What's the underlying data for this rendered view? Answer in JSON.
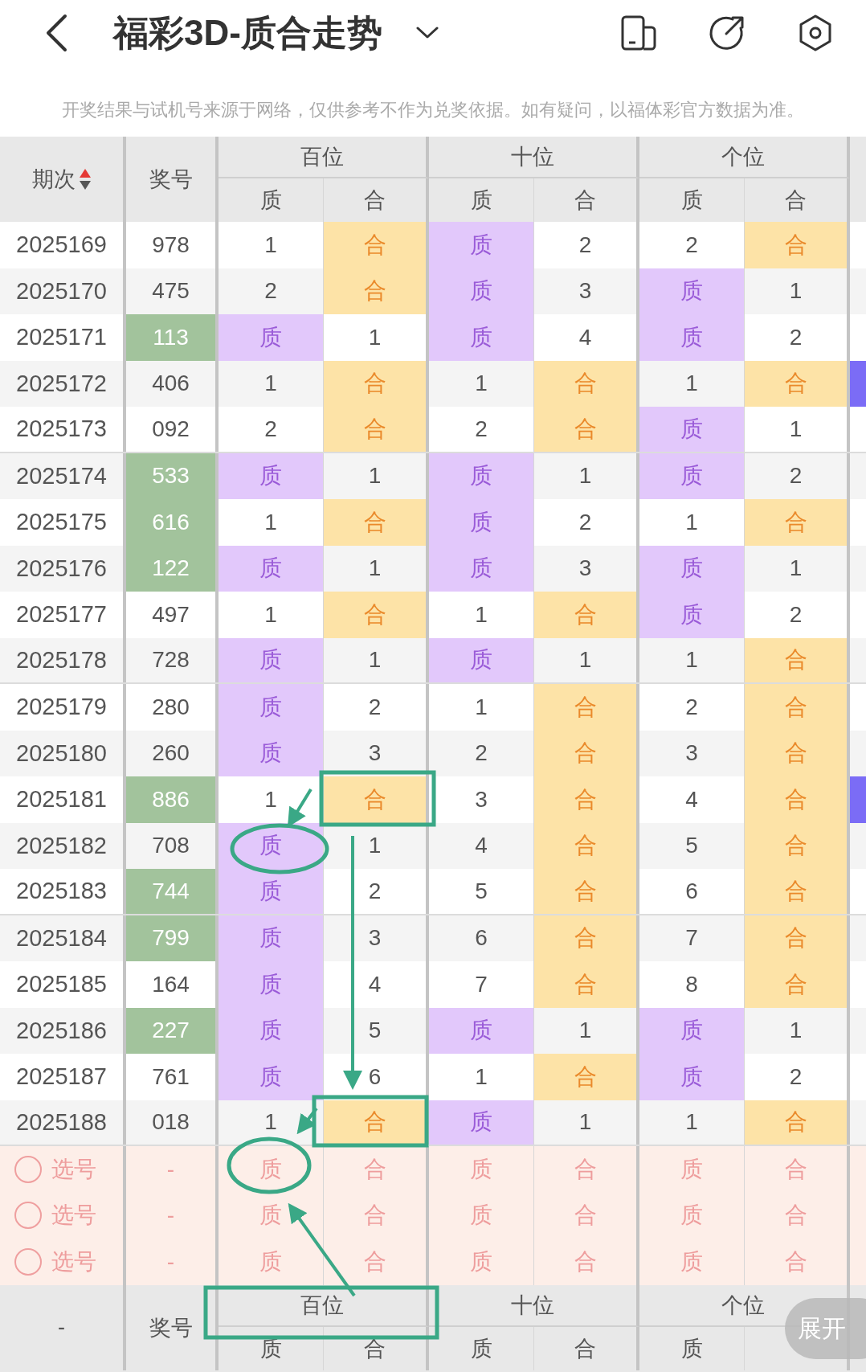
{
  "top_bar": {
    "title": "福彩3D-质合走势"
  },
  "notice": "开奖结果与试机号来源于网络，仅供参考不作为兑奖依据。如有疑问，以福体彩官方数据为准。",
  "table": {
    "header": {
      "issue": "期次",
      "number": "奖号",
      "groups": [
        {
          "label": "百位",
          "subs": [
            "质",
            "合"
          ]
        },
        {
          "label": "十位",
          "subs": [
            "质",
            "合"
          ]
        },
        {
          "label": "个位",
          "subs": [
            "质",
            "合"
          ]
        }
      ]
    },
    "rows": [
      {
        "issue": "2025169",
        "number": "978",
        "highlight": false,
        "edge_marker": false,
        "cells": [
          {
            "text": "1",
            "hit": false
          },
          {
            "text": "合",
            "hit": true
          },
          {
            "text": "质",
            "hit": true
          },
          {
            "text": "2",
            "hit": false
          },
          {
            "text": "2",
            "hit": false
          },
          {
            "text": "合",
            "hit": true
          }
        ]
      },
      {
        "issue": "2025170",
        "number": "475",
        "highlight": false,
        "edge_marker": false,
        "cells": [
          {
            "text": "2",
            "hit": false
          },
          {
            "text": "合",
            "hit": true
          },
          {
            "text": "质",
            "hit": true
          },
          {
            "text": "3",
            "hit": false
          },
          {
            "text": "质",
            "hit": true
          },
          {
            "text": "1",
            "hit": false
          }
        ]
      },
      {
        "issue": "2025171",
        "number": "113",
        "highlight": true,
        "edge_marker": false,
        "cells": [
          {
            "text": "质",
            "hit": true
          },
          {
            "text": "1",
            "hit": false
          },
          {
            "text": "质",
            "hit": true
          },
          {
            "text": "4",
            "hit": false
          },
          {
            "text": "质",
            "hit": true
          },
          {
            "text": "2",
            "hit": false
          }
        ]
      },
      {
        "issue": "2025172",
        "number": "406",
        "highlight": false,
        "edge_marker": true,
        "cells": [
          {
            "text": "1",
            "hit": false
          },
          {
            "text": "合",
            "hit": true
          },
          {
            "text": "1",
            "hit": false
          },
          {
            "text": "合",
            "hit": true
          },
          {
            "text": "1",
            "hit": false
          },
          {
            "text": "合",
            "hit": true
          }
        ]
      },
      {
        "issue": "2025173",
        "number": "092",
        "highlight": false,
        "edge_marker": false,
        "cells": [
          {
            "text": "2",
            "hit": false
          },
          {
            "text": "合",
            "hit": true
          },
          {
            "text": "2",
            "hit": false
          },
          {
            "text": "合",
            "hit": true
          },
          {
            "text": "质",
            "hit": true
          },
          {
            "text": "1",
            "hit": false
          }
        ]
      },
      {
        "issue": "2025174",
        "number": "533",
        "highlight": true,
        "edge_marker": false,
        "cells": [
          {
            "text": "质",
            "hit": true
          },
          {
            "text": "1",
            "hit": false
          },
          {
            "text": "质",
            "hit": true
          },
          {
            "text": "1",
            "hit": false
          },
          {
            "text": "质",
            "hit": true
          },
          {
            "text": "2",
            "hit": false
          }
        ]
      },
      {
        "issue": "2025175",
        "number": "616",
        "highlight": true,
        "edge_marker": false,
        "cells": [
          {
            "text": "1",
            "hit": false
          },
          {
            "text": "合",
            "hit": true
          },
          {
            "text": "质",
            "hit": true
          },
          {
            "text": "2",
            "hit": false
          },
          {
            "text": "1",
            "hit": false
          },
          {
            "text": "合",
            "hit": true
          }
        ]
      },
      {
        "issue": "2025176",
        "number": "122",
        "highlight": true,
        "edge_marker": false,
        "cells": [
          {
            "text": "质",
            "hit": true
          },
          {
            "text": "1",
            "hit": false
          },
          {
            "text": "质",
            "hit": true
          },
          {
            "text": "3",
            "hit": false
          },
          {
            "text": "质",
            "hit": true
          },
          {
            "text": "1",
            "hit": false
          }
        ]
      },
      {
        "issue": "2025177",
        "number": "497",
        "highlight": false,
        "edge_marker": false,
        "cells": [
          {
            "text": "1",
            "hit": false
          },
          {
            "text": "合",
            "hit": true
          },
          {
            "text": "1",
            "hit": false
          },
          {
            "text": "合",
            "hit": true
          },
          {
            "text": "质",
            "hit": true
          },
          {
            "text": "2",
            "hit": false
          }
        ]
      },
      {
        "issue": "2025178",
        "number": "728",
        "highlight": false,
        "edge_marker": false,
        "cells": [
          {
            "text": "质",
            "hit": true
          },
          {
            "text": "1",
            "hit": false
          },
          {
            "text": "质",
            "hit": true
          },
          {
            "text": "1",
            "hit": false
          },
          {
            "text": "1",
            "hit": false
          },
          {
            "text": "合",
            "hit": true
          }
        ]
      },
      {
        "issue": "2025179",
        "number": "280",
        "highlight": false,
        "edge_marker": false,
        "cells": [
          {
            "text": "质",
            "hit": true
          },
          {
            "text": "2",
            "hit": false
          },
          {
            "text": "1",
            "hit": false
          },
          {
            "text": "合",
            "hit": true
          },
          {
            "text": "2",
            "hit": false
          },
          {
            "text": "合",
            "hit": true
          }
        ]
      },
      {
        "issue": "2025180",
        "number": "260",
        "highlight": false,
        "edge_marker": false,
        "cells": [
          {
            "text": "质",
            "hit": true
          },
          {
            "text": "3",
            "hit": false
          },
          {
            "text": "2",
            "hit": false
          },
          {
            "text": "合",
            "hit": true
          },
          {
            "text": "3",
            "hit": false
          },
          {
            "text": "合",
            "hit": true
          }
        ]
      },
      {
        "issue": "2025181",
        "number": "886",
        "highlight": true,
        "edge_marker": true,
        "cells": [
          {
            "text": "1",
            "hit": false
          },
          {
            "text": "合",
            "hit": true
          },
          {
            "text": "3",
            "hit": false
          },
          {
            "text": "合",
            "hit": true
          },
          {
            "text": "4",
            "hit": false
          },
          {
            "text": "合",
            "hit": true
          }
        ]
      },
      {
        "issue": "2025182",
        "number": "708",
        "highlight": false,
        "edge_marker": false,
        "cells": [
          {
            "text": "质",
            "hit": true
          },
          {
            "text": "1",
            "hit": false
          },
          {
            "text": "4",
            "hit": false
          },
          {
            "text": "合",
            "hit": true
          },
          {
            "text": "5",
            "hit": false
          },
          {
            "text": "合",
            "hit": true
          }
        ]
      },
      {
        "issue": "2025183",
        "number": "744",
        "highlight": true,
        "edge_marker": false,
        "cells": [
          {
            "text": "质",
            "hit": true
          },
          {
            "text": "2",
            "hit": false
          },
          {
            "text": "5",
            "hit": false
          },
          {
            "text": "合",
            "hit": true
          },
          {
            "text": "6",
            "hit": false
          },
          {
            "text": "合",
            "hit": true
          }
        ]
      },
      {
        "issue": "2025184",
        "number": "799",
        "highlight": true,
        "edge_marker": false,
        "cells": [
          {
            "text": "质",
            "hit": true
          },
          {
            "text": "3",
            "hit": false
          },
          {
            "text": "6",
            "hit": false
          },
          {
            "text": "合",
            "hit": true
          },
          {
            "text": "7",
            "hit": false
          },
          {
            "text": "合",
            "hit": true
          }
        ]
      },
      {
        "issue": "2025185",
        "number": "164",
        "highlight": false,
        "edge_marker": false,
        "cells": [
          {
            "text": "质",
            "hit": true
          },
          {
            "text": "4",
            "hit": false
          },
          {
            "text": "7",
            "hit": false
          },
          {
            "text": "合",
            "hit": true
          },
          {
            "text": "8",
            "hit": false
          },
          {
            "text": "合",
            "hit": true
          }
        ]
      },
      {
        "issue": "2025186",
        "number": "227",
        "highlight": true,
        "edge_marker": false,
        "cells": [
          {
            "text": "质",
            "hit": true
          },
          {
            "text": "5",
            "hit": false
          },
          {
            "text": "质",
            "hit": true
          },
          {
            "text": "1",
            "hit": false
          },
          {
            "text": "质",
            "hit": true
          },
          {
            "text": "1",
            "hit": false
          }
        ]
      },
      {
        "issue": "2025187",
        "number": "761",
        "highlight": false,
        "edge_marker": false,
        "cells": [
          {
            "text": "质",
            "hit": true
          },
          {
            "text": "6",
            "hit": false
          },
          {
            "text": "1",
            "hit": false
          },
          {
            "text": "合",
            "hit": true
          },
          {
            "text": "质",
            "hit": true
          },
          {
            "text": "2",
            "hit": false
          }
        ]
      },
      {
        "issue": "2025188",
        "number": "018",
        "highlight": false,
        "edge_marker": false,
        "cells": [
          {
            "text": "1",
            "hit": false
          },
          {
            "text": "合",
            "hit": true
          },
          {
            "text": "质",
            "hit": true
          },
          {
            "text": "1",
            "hit": false
          },
          {
            "text": "1",
            "hit": false
          },
          {
            "text": "合",
            "hit": true
          }
        ]
      }
    ],
    "pick_rows": [
      {
        "label": "选号",
        "number": "-",
        "checked": false,
        "cells": [
          "质",
          "合",
          "质",
          "合",
          "质",
          "合"
        ]
      },
      {
        "label": "选号",
        "number": "-",
        "checked": false,
        "cells": [
          "质",
          "合",
          "质",
          "合",
          "质",
          "合"
        ]
      },
      {
        "label": "选号",
        "number": "-",
        "checked": false,
        "cells": [
          "质",
          "合",
          "质",
          "合",
          "质",
          "合"
        ]
      }
    ],
    "footer": {
      "issue": "-",
      "number": "奖号",
      "groups": [
        {
          "label": "百位",
          "subs": [
            "质",
            "合"
          ]
        },
        {
          "label": "十位",
          "subs": [
            "质",
            "合"
          ]
        },
        {
          "label": "个位",
          "subs": [
            "质"
          ]
        }
      ]
    }
  },
  "expand_button": "展开"
}
